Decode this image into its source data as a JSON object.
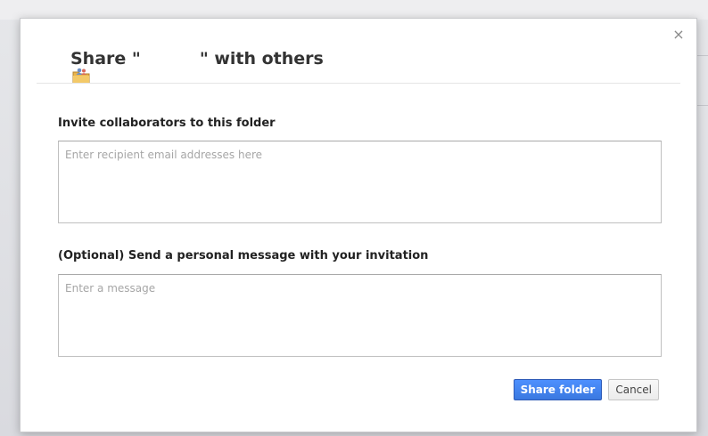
{
  "dialog": {
    "title_prefix": "Share \"",
    "title_suffix": "\" with others",
    "close_glyph": "×"
  },
  "invite": {
    "label": "Invite collaborators to this folder",
    "placeholder": "Enter recipient email addresses here"
  },
  "message": {
    "label": "(Optional) Send a personal message with your invitation",
    "placeholder": "Enter a message"
  },
  "actions": {
    "share_label": "Share folder",
    "cancel_label": "Cancel"
  },
  "icons": {
    "title_icon": "shared-folder-icon",
    "close_icon": "close-icon"
  },
  "colors": {
    "primary_button": "#3a78e0",
    "title_text": "#333333"
  }
}
